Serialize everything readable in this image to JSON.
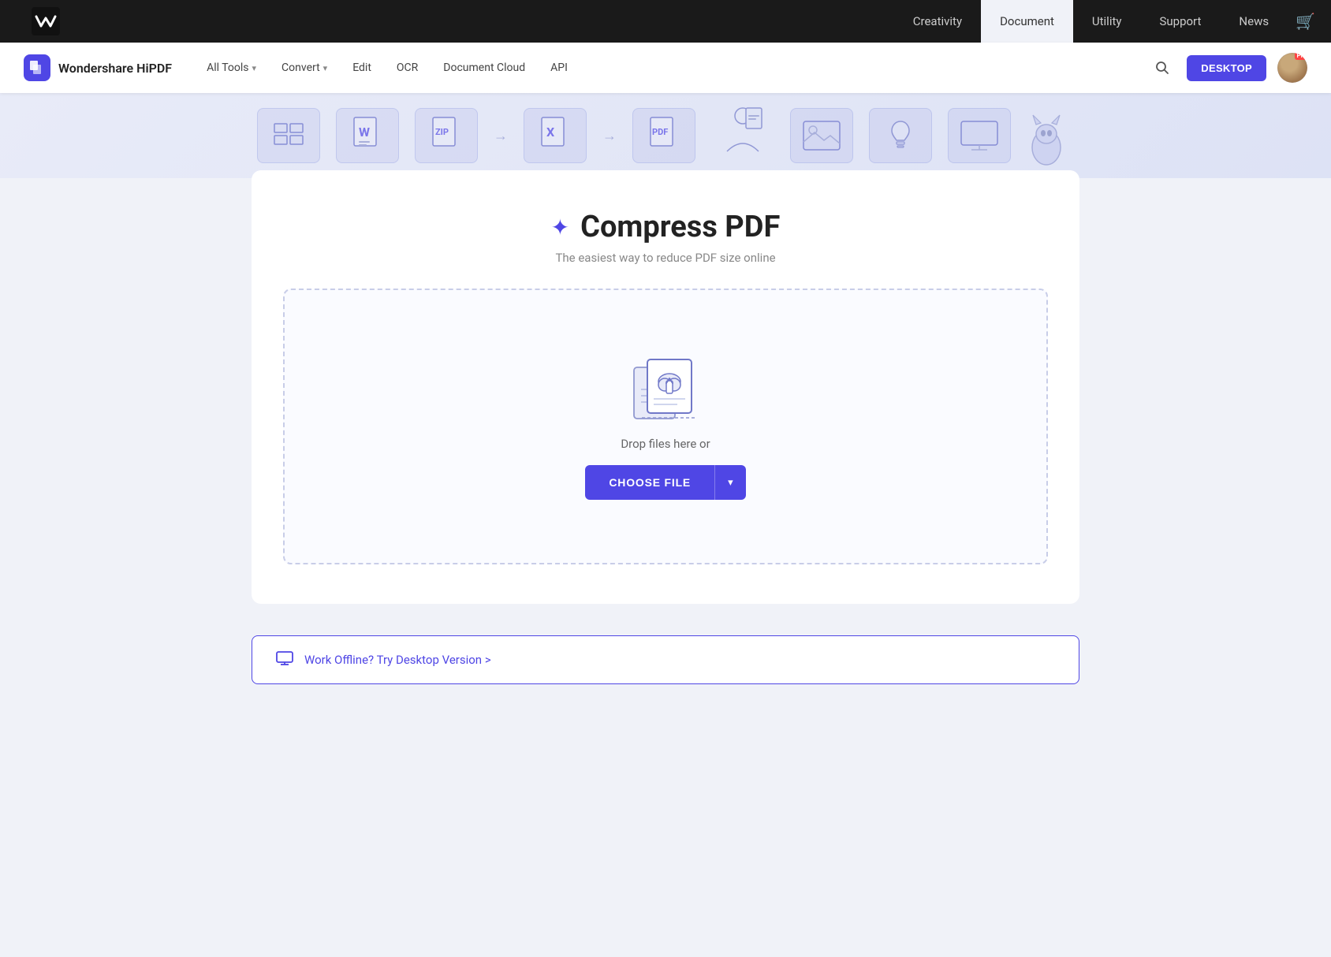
{
  "topNav": {
    "logo_alt": "Wondershare",
    "links": [
      {
        "id": "creativity",
        "label": "Creativity",
        "active": false
      },
      {
        "id": "document",
        "label": "Document",
        "active": true
      },
      {
        "id": "utility",
        "label": "Utility",
        "active": false
      },
      {
        "id": "support",
        "label": "Support",
        "active": false
      },
      {
        "id": "news",
        "label": "News",
        "active": false
      }
    ]
  },
  "secNav": {
    "brand": "Wondershare HiPDF",
    "links": [
      {
        "id": "all-tools",
        "label": "All Tools",
        "hasDropdown": true
      },
      {
        "id": "convert",
        "label": "Convert",
        "hasDropdown": true
      },
      {
        "id": "edit",
        "label": "Edit",
        "hasDropdown": false
      },
      {
        "id": "ocr",
        "label": "OCR",
        "hasDropdown": false
      },
      {
        "id": "document-cloud",
        "label": "Document Cloud",
        "hasDropdown": false
      },
      {
        "id": "api",
        "label": "API",
        "hasDropdown": false
      }
    ],
    "desktop_btn": "DESKTOP",
    "pro_badge": "Pro"
  },
  "page": {
    "title": "Compress PDF",
    "subtitle": "The easiest way to reduce PDF size online",
    "drop_text": "Drop files here or",
    "choose_file_btn": "CHOOSE FILE",
    "offline_text": "Work Offline? Try Desktop Version >",
    "accent_color": "#4f46e5"
  }
}
